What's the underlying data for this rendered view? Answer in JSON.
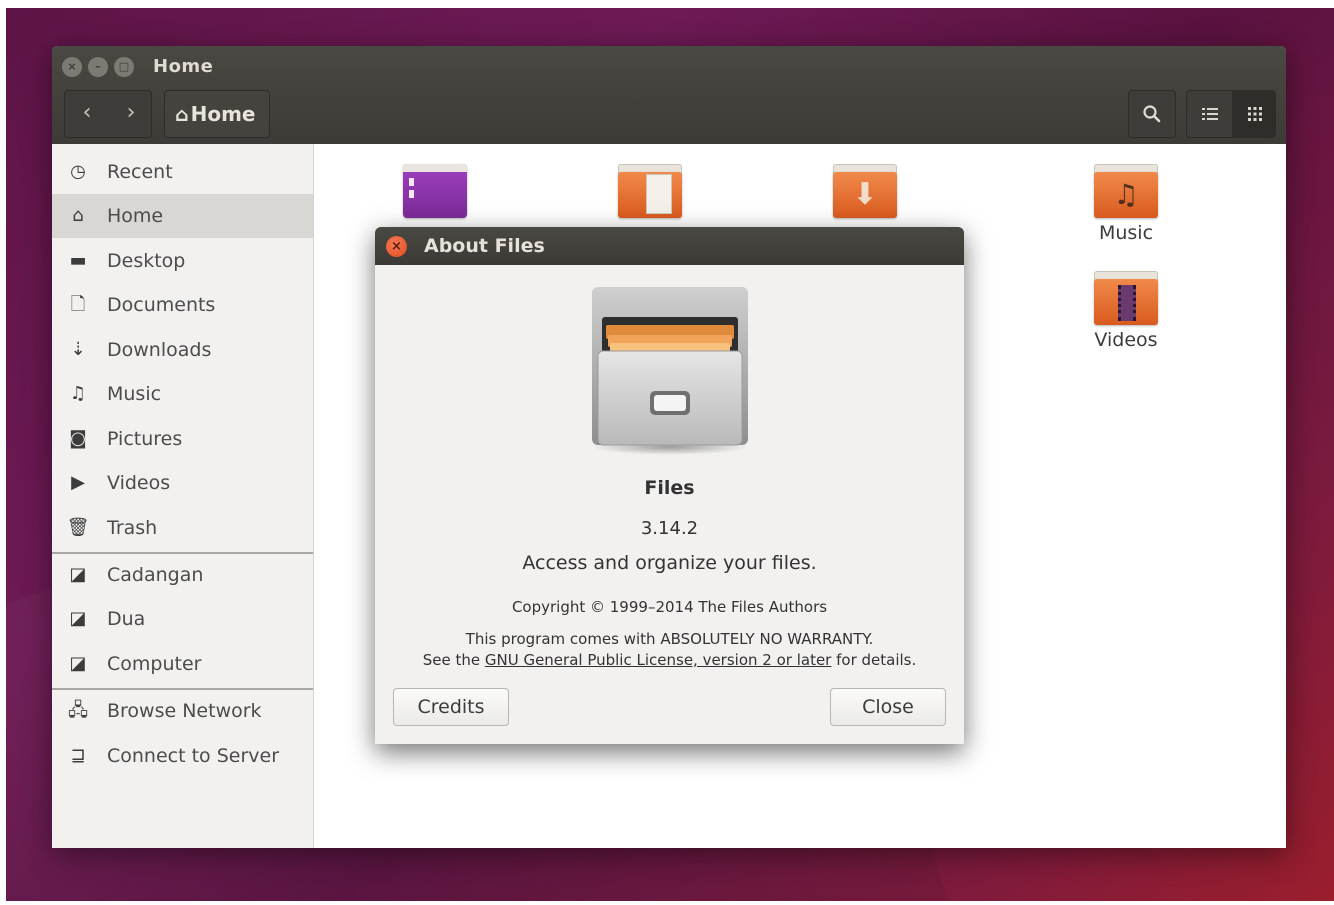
{
  "window": {
    "title": "Home",
    "breadcrumb": "Home"
  },
  "sidebar": {
    "items": [
      {
        "label": "Recent",
        "icon": "clock-icon"
      },
      {
        "label": "Home",
        "icon": "home-icon",
        "active": true
      },
      {
        "label": "Desktop",
        "icon": "desktop-folder-icon"
      },
      {
        "label": "Documents",
        "icon": "document-icon"
      },
      {
        "label": "Downloads",
        "icon": "download-icon"
      },
      {
        "label": "Music",
        "icon": "music-icon"
      },
      {
        "label": "Pictures",
        "icon": "camera-icon"
      },
      {
        "label": "Videos",
        "icon": "video-icon"
      },
      {
        "label": "Trash",
        "icon": "trash-icon"
      }
    ],
    "devices": [
      {
        "label": "Cadangan",
        "icon": "drive-icon"
      },
      {
        "label": "Dua",
        "icon": "drive-icon"
      },
      {
        "label": "Computer",
        "icon": "drive-icon"
      }
    ],
    "network": [
      {
        "label": "Browse Network",
        "icon": "network-icon"
      },
      {
        "label": "Connect to Server",
        "icon": "server-icon"
      }
    ]
  },
  "content": {
    "folders": [
      {
        "label": "Music",
        "icon": "music-folder-icon"
      },
      {
        "label": "Videos",
        "icon": "video-folder-icon"
      }
    ]
  },
  "dialog": {
    "title": "About Files",
    "app_name": "Files",
    "version": "3.14.2",
    "description": "Access and organize your files.",
    "copyright": "Copyright © 1999–2014 The Files Authors",
    "warranty_line1": "This program comes with ABSOLUTELY NO WARRANTY.",
    "warranty_prefix": "See the ",
    "license_link": "GNU General Public License, version 2 or later",
    "warranty_suffix": " for details.",
    "credits_button": "Credits",
    "close_button": "Close"
  },
  "colors": {
    "accent": "#df4b1f",
    "folder": "#e8733a",
    "titlebar": "#3d3b37"
  }
}
